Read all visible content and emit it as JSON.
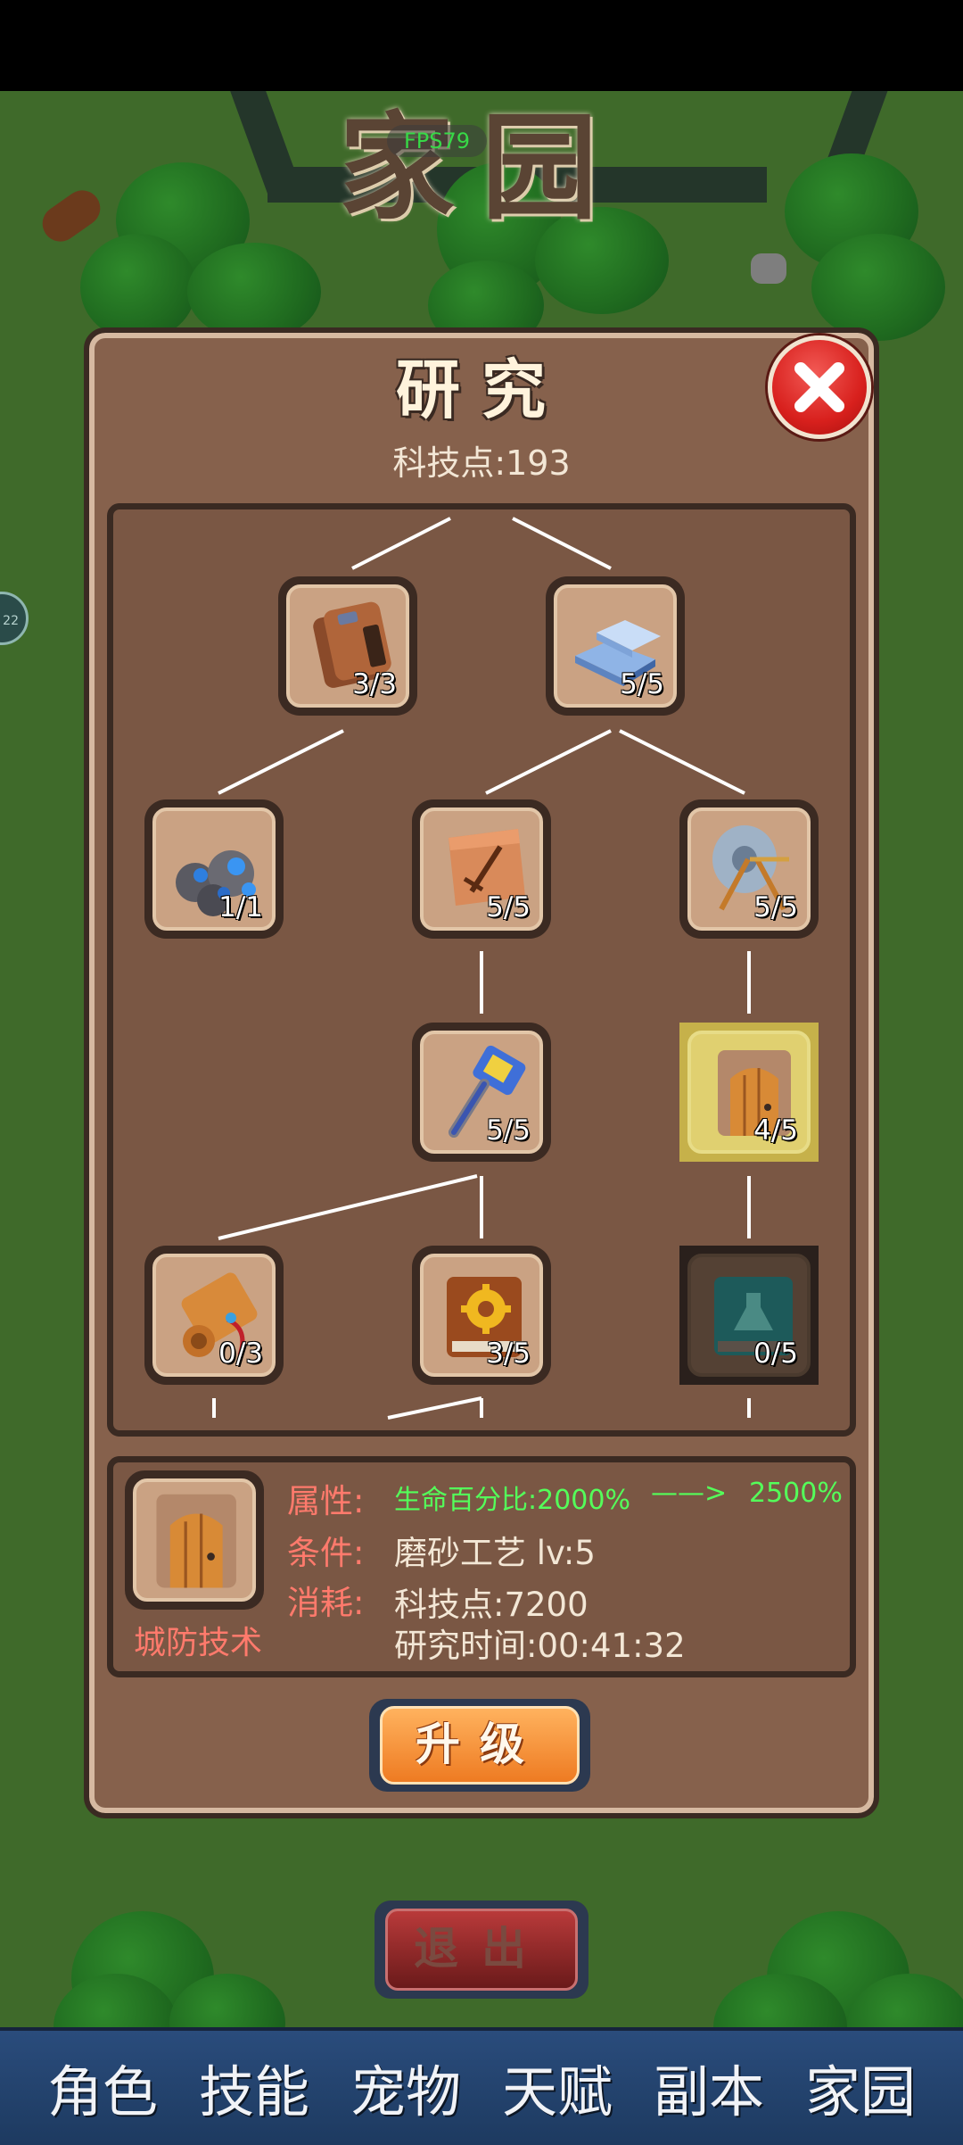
{
  "scene": {
    "home_title": "家园",
    "fps": "FPS79",
    "side_badge": "22"
  },
  "research": {
    "title": "研究",
    "tech_points": "科技点:193",
    "nodes": [
      {
        "id": "bag",
        "count": "3/3"
      },
      {
        "id": "ingot",
        "count": "5/5"
      },
      {
        "id": "ore",
        "count": "1/1"
      },
      {
        "id": "scroll-sword",
        "count": "5/5"
      },
      {
        "id": "grindstone",
        "count": "5/5"
      },
      {
        "id": "hammer",
        "count": "5/5"
      },
      {
        "id": "door",
        "count": "4/5"
      },
      {
        "id": "scroll",
        "count": "0/3"
      },
      {
        "id": "gear-book",
        "count": "3/5"
      },
      {
        "id": "potion-book",
        "count": "0/5"
      }
    ]
  },
  "info": {
    "name": "城防技术",
    "attr_label": "属性:",
    "attr_value": "生命百分比:2000%",
    "attr_arrow": "——>",
    "attr_next": "2500%",
    "cond_label": "条件:",
    "cond_value": "磨砂工艺 lv:5",
    "cost_label": "消耗:",
    "cost_value": "科技点:7200",
    "time_value": "研究时间:00:41:32"
  },
  "buttons": {
    "upgrade": "升级",
    "exit": "退出"
  },
  "nav": {
    "items": [
      "角色",
      "技能",
      "宠物",
      "天赋",
      "副本",
      "家园"
    ]
  },
  "colors": {
    "panel": "#86614c",
    "panel_border": "#3a2a22",
    "accent_red": "#ff7a6c",
    "accent_green": "#54ff5a",
    "nav_bg": "#2a4c7c"
  }
}
